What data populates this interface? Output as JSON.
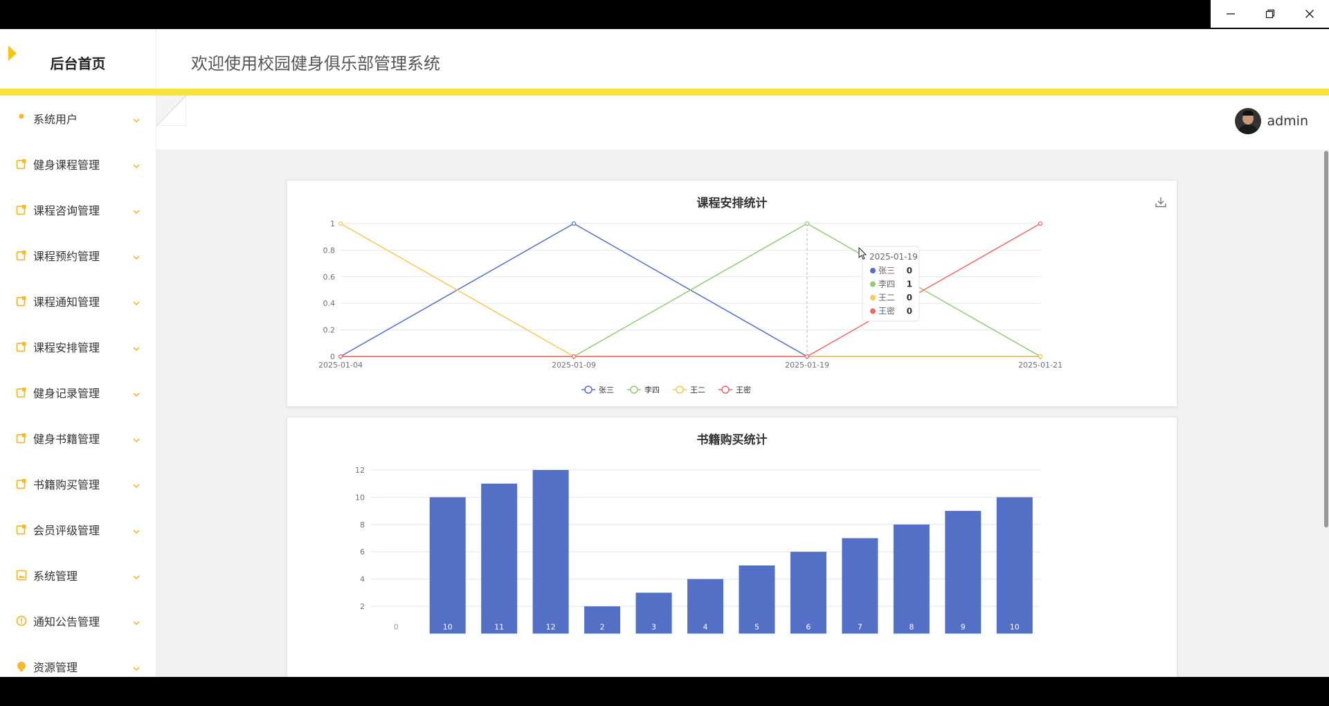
{
  "window": {
    "controls": [
      "minimize",
      "restore",
      "close"
    ]
  },
  "header": {
    "brand_title": "后台首页",
    "system_title": "欢迎使用校园健身俱乐部管理系统"
  },
  "sidebar": {
    "items": [
      {
        "label": "系统用户",
        "icon": "user-icon"
      },
      {
        "label": "健身课程管理",
        "icon": "edit-icon"
      },
      {
        "label": "课程咨询管理",
        "icon": "edit-icon"
      },
      {
        "label": "课程预约管理",
        "icon": "edit-icon"
      },
      {
        "label": "课程通知管理",
        "icon": "edit-icon"
      },
      {
        "label": "课程安排管理",
        "icon": "edit-icon"
      },
      {
        "label": "健身记录管理",
        "icon": "edit-icon"
      },
      {
        "label": "健身书籍管理",
        "icon": "edit-icon"
      },
      {
        "label": "书籍购买管理",
        "icon": "edit-icon"
      },
      {
        "label": "会员评级管理",
        "icon": "edit-icon"
      },
      {
        "label": "系统管理",
        "icon": "image-icon"
      },
      {
        "label": "通知公告管理",
        "icon": "info-icon"
      },
      {
        "label": "资源管理",
        "icon": "circle-icon"
      }
    ]
  },
  "user": {
    "name": "admin"
  },
  "colors": {
    "accent": "#f9e33a",
    "icon": "#f5b82e",
    "series": [
      "#5470c6",
      "#91cc75",
      "#fac858",
      "#ee6666"
    ]
  },
  "chart_data": [
    {
      "type": "line",
      "title": "课程安排统计",
      "x": [
        "2025-01-04",
        "2025-01-09",
        "2025-01-19",
        "2025-01-21"
      ],
      "series": [
        {
          "name": "张三",
          "values": [
            0,
            1,
            0,
            0
          ]
        },
        {
          "name": "李四",
          "values": [
            0,
            0,
            1,
            0
          ]
        },
        {
          "name": "王二",
          "values": [
            1,
            0,
            0,
            0
          ]
        },
        {
          "name": "王密",
          "values": [
            0,
            0,
            0,
            1
          ]
        }
      ],
      "ylim": [
        0,
        1
      ],
      "yticks": [
        "0",
        "0.2",
        "0.4",
        "0.6",
        "0.8",
        "1"
      ],
      "legend": "bottom-center",
      "grid": true,
      "tooltip": {
        "date": "2025-01-19",
        "rows": [
          {
            "name": "张三",
            "value": "0"
          },
          {
            "name": "李四",
            "value": "1"
          },
          {
            "name": "王二",
            "value": "0"
          },
          {
            "name": "王密",
            "value": "0"
          }
        ]
      }
    },
    {
      "type": "bar",
      "title": "书籍购买统计",
      "values": [
        0,
        10,
        11,
        12,
        2,
        3,
        4,
        5,
        6,
        7,
        8,
        9,
        10
      ],
      "data_labels": [
        "0",
        "10",
        "11",
        "12",
        "2",
        "3",
        "4",
        "5",
        "6",
        "7",
        "8",
        "9",
        "10"
      ],
      "yticks": [
        "2",
        "4",
        "6",
        "8",
        "10",
        "12"
      ],
      "ylim": [
        0,
        12
      ],
      "grid": true
    }
  ]
}
